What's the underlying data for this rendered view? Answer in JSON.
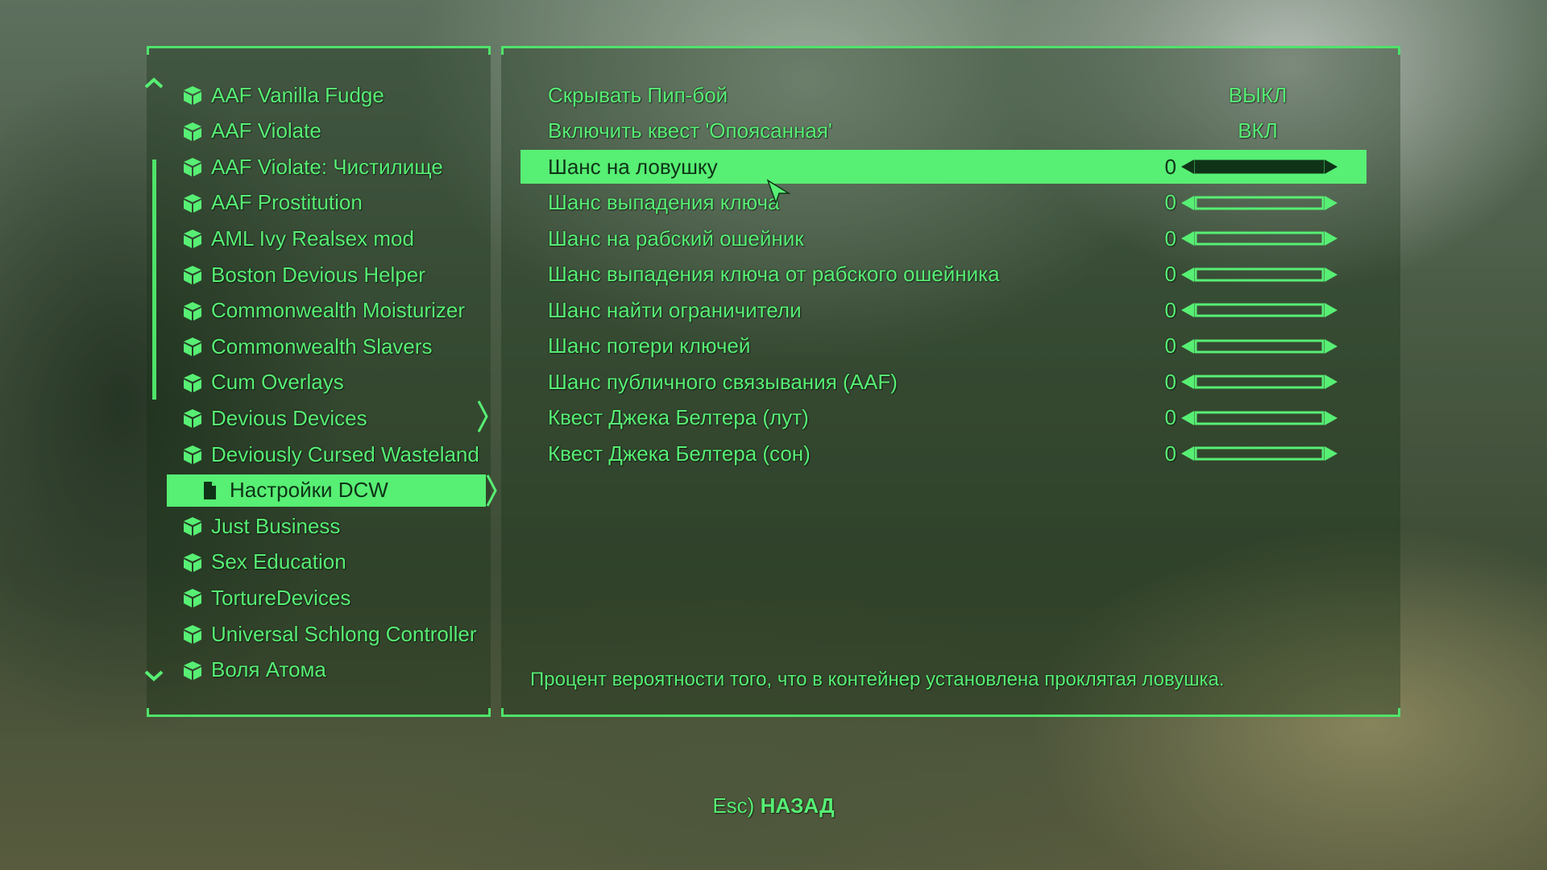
{
  "colors": {
    "accent": "#57ef74",
    "selected_text": "#0f3317"
  },
  "mod_list": {
    "items": [
      {
        "label": "AAF Vanilla Fudge",
        "icon": "box-icon"
      },
      {
        "label": "AAF Violate",
        "icon": "box-icon"
      },
      {
        "label": "AAF Violate: Чистилище",
        "icon": "box-icon"
      },
      {
        "label": "AAF Prostitution",
        "icon": "box-icon"
      },
      {
        "label": "AML Ivy Realsex mod",
        "icon": "box-icon"
      },
      {
        "label": "Boston Devious Helper",
        "icon": "box-icon"
      },
      {
        "label": "Commonwealth Moisturizer",
        "icon": "box-icon"
      },
      {
        "label": "Commonwealth Slavers",
        "icon": "box-icon"
      },
      {
        "label": "Cum Overlays",
        "icon": "box-icon"
      },
      {
        "label": "Devious Devices",
        "icon": "box-icon"
      },
      {
        "label": "Deviously Cursed Wasteland",
        "icon": "box-icon"
      },
      {
        "label": "Настройки DCW",
        "icon": "document-icon",
        "selected": true
      },
      {
        "label": "Just Business",
        "icon": "box-icon"
      },
      {
        "label": "Sex Education",
        "icon": "box-icon"
      },
      {
        "label": "TortureDevices",
        "icon": "box-icon"
      },
      {
        "label": "Universal Schlong Controller",
        "icon": "box-icon"
      },
      {
        "label": "Воля Атома",
        "icon": "box-icon"
      }
    ]
  },
  "settings": {
    "rows": [
      {
        "label": "Скрывать Пип-бой",
        "type": "toggle",
        "value": "ВЫКЛ"
      },
      {
        "label": "Включить квест 'Опоясанная'",
        "type": "toggle",
        "value": "ВКЛ"
      },
      {
        "label": "Шанс на ловушку",
        "type": "slider",
        "value": "0",
        "level": 0,
        "selected": true
      },
      {
        "label": "Шанс выпадения ключа",
        "type": "slider",
        "value": "0",
        "level": 0
      },
      {
        "label": "Шанс на рабский ошейник",
        "type": "slider",
        "value": "0",
        "level": 0
      },
      {
        "label": "Шанс выпадения ключа от рабского ошейника",
        "type": "slider",
        "value": "0",
        "level": 0
      },
      {
        "label": "Шанс найти ограничители",
        "type": "slider",
        "value": "0",
        "level": 0
      },
      {
        "label": "Шанс потери ключей",
        "type": "slider",
        "value": "0",
        "level": 0
      },
      {
        "label": "Шанс публичного связывания (AAF)",
        "type": "slider",
        "value": "0",
        "level": 0
      },
      {
        "label": "Квест Джека Белтера (лут)",
        "type": "slider",
        "value": "0",
        "level": 0
      },
      {
        "label": "Квест Джека Белтера (сон)",
        "type": "slider",
        "value": "0",
        "level": 0
      }
    ],
    "description": "Процент вероятности того, что в контейнер установлена проклятая ловушка."
  },
  "footer": {
    "key": "Esc)",
    "action": "НАЗАД"
  }
}
